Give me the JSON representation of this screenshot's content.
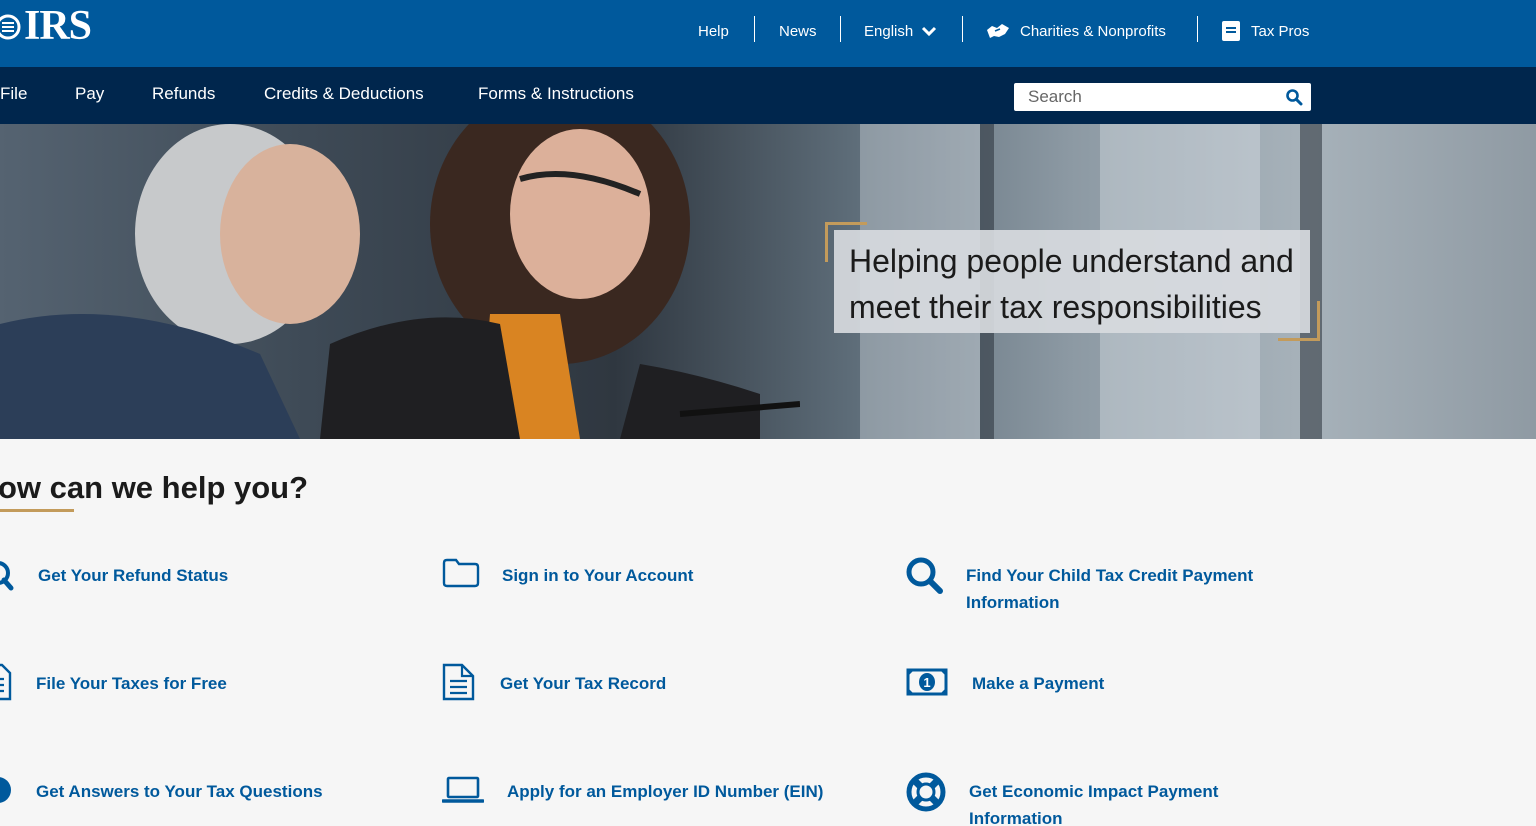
{
  "header": {
    "logo_text": "IRS",
    "links": {
      "help": "Help",
      "news": "News",
      "language": "English",
      "charities": "Charities & Nonprofits",
      "tax_pros": "Tax Pros"
    }
  },
  "nav": {
    "items": [
      "File",
      "Pay",
      "Refunds",
      "Credits & Deductions",
      "Forms & Instructions"
    ],
    "search_placeholder": "Search"
  },
  "hero": {
    "tagline_line1": "Helping people understand and",
    "tagline_line2": "meet their tax responsibilities"
  },
  "help": {
    "title": "ow can we help you?",
    "links": [
      {
        "label": "Get Your Refund Status",
        "icon": "search-icon"
      },
      {
        "label": "Sign in to Your Account",
        "icon": "folder-icon"
      },
      {
        "label": "Find Your Child Tax Credit Payment",
        "label2": "Information",
        "icon": "search-icon"
      },
      {
        "label": "File Your Taxes for Free",
        "icon": "document-icon"
      },
      {
        "label": "Get Your Tax Record",
        "icon": "document-icon"
      },
      {
        "label": "Make a Payment",
        "icon": "money-icon"
      },
      {
        "label": "Get Answers to Your Tax Questions",
        "icon": "question-icon"
      },
      {
        "label": "Apply for an Employer ID Number (EIN)",
        "icon": "laptop-icon"
      },
      {
        "label": "Get Economic Impact Payment",
        "label2": "Information",
        "icon": "life-ring-icon"
      }
    ]
  },
  "colors": {
    "topbar": "#00599c",
    "navbar": "#00264d",
    "link": "#00599c",
    "accent": "#c39b5b"
  }
}
